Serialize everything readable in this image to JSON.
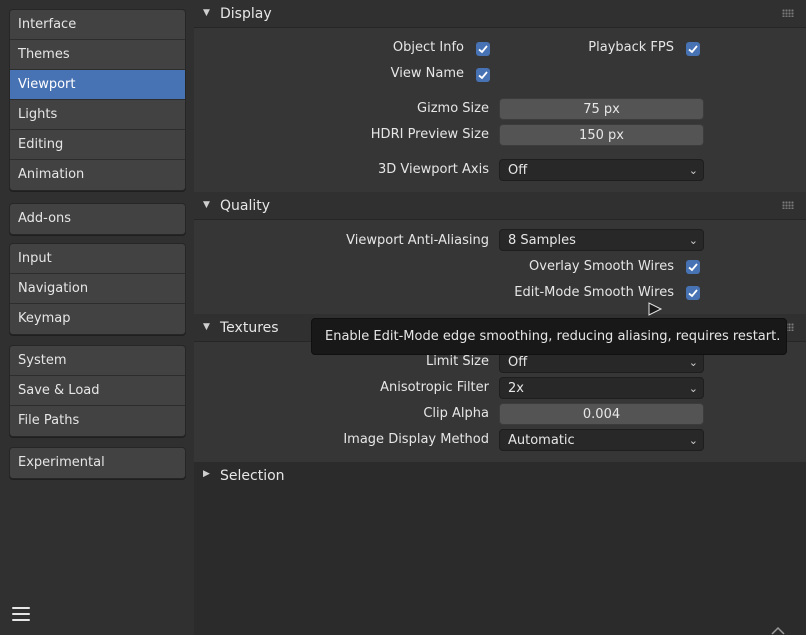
{
  "sidebar": {
    "groups": [
      {
        "items": [
          "Interface",
          "Themes",
          "Viewport",
          "Lights",
          "Editing",
          "Animation"
        ]
      },
      {
        "items": [
          "Add-ons"
        ]
      },
      {
        "items": [
          "Input",
          "Navigation",
          "Keymap"
        ]
      },
      {
        "items": [
          "System",
          "Save & Load",
          "File Paths"
        ]
      },
      {
        "items": [
          "Experimental"
        ]
      }
    ],
    "active": "Viewport"
  },
  "panels": {
    "display": {
      "title": "Display",
      "object_info": "Object Info",
      "playback_fps": "Playback FPS",
      "view_name": "View Name",
      "gizmo_size_label": "Gizmo Size",
      "gizmo_size_value": "75 px",
      "hdri_label": "HDRI Preview Size",
      "hdri_value": "150 px",
      "axis_label": "3D Viewport Axis",
      "axis_value": "Off"
    },
    "quality": {
      "title": "Quality",
      "aa_label": "Viewport Anti-Aliasing",
      "aa_value": "8 Samples",
      "overlay_smooth": "Overlay Smooth Wires",
      "edit_smooth": "Edit-Mode Smooth Wires"
    },
    "textures": {
      "title": "Textures",
      "limit_label": "Limit Size",
      "limit_value": "Off",
      "aniso_label": "Anisotropic Filter",
      "aniso_value": "2x",
      "clip_label": "Clip Alpha",
      "clip_value": "0.004",
      "display_method_label": "Image Display Method",
      "display_method_value": "Automatic"
    },
    "selection": {
      "title": "Selection"
    }
  },
  "tooltip": "Enable Edit-Mode edge smoothing, reducing aliasing, requires restart.",
  "colors": {
    "accent": "#4772b3",
    "panel": "#363636",
    "background": "#2b2b2b"
  }
}
